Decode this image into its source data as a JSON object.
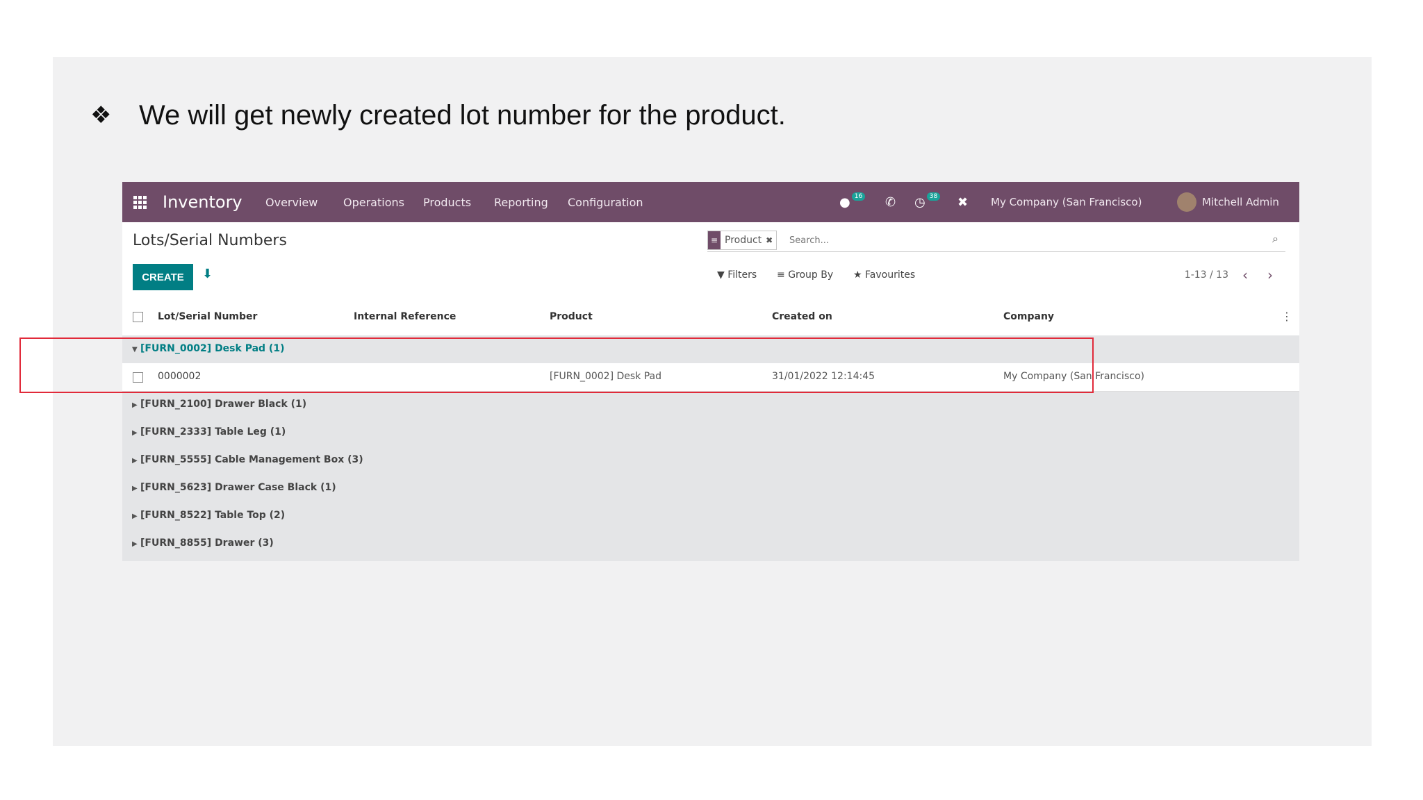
{
  "slide": {
    "bullet_icon": "four-diamond-bullet",
    "bullet_glyph": "❖",
    "text": "We will get newly created lot number for the product."
  },
  "navbar": {
    "app_title": "Inventory",
    "menu": [
      "Overview",
      "Operations",
      "Products",
      "Reporting",
      "Configuration"
    ],
    "messages_badge": "16",
    "activities_badge": "38",
    "company": "My Company (San Francisco)",
    "user": "Mitchell Admin"
  },
  "control_panel": {
    "title": "Lots/Serial Numbers",
    "create_label": "CREATE",
    "facet_label": "Product",
    "search_placeholder": "Search...",
    "filters_label": "Filters",
    "groupby_label": "Group By",
    "favourites_label": "Favourites",
    "pager": "1-13 / 13"
  },
  "table": {
    "columns": [
      "Lot/Serial Number",
      "Internal Reference",
      "Product",
      "Created on",
      "Company"
    ],
    "groups": [
      {
        "label": "[FURN_0002] Desk Pad (1)",
        "open": true
      },
      {
        "label": "[FURN_2100] Drawer Black (1)",
        "open": false
      },
      {
        "label": "[FURN_2333] Table Leg (1)",
        "open": false
      },
      {
        "label": "[FURN_5555] Cable Management Box (3)",
        "open": false
      },
      {
        "label": "[FURN_5623] Drawer Case Black (1)",
        "open": false
      },
      {
        "label": "[FURN_8522] Table Top (2)",
        "open": false
      },
      {
        "label": "[FURN_8855] Drawer (3)",
        "open": false
      }
    ],
    "row": {
      "lot": "0000002",
      "internal_ref": "",
      "product": "[FURN_0002] Desk Pad",
      "created_on": "31/01/2022 12:14:45",
      "company": "My Company (San Francisco)"
    }
  },
  "colors": {
    "navbar": "#6f4c68",
    "primary": "#017e84",
    "highlight_border": "#e12a3a"
  }
}
